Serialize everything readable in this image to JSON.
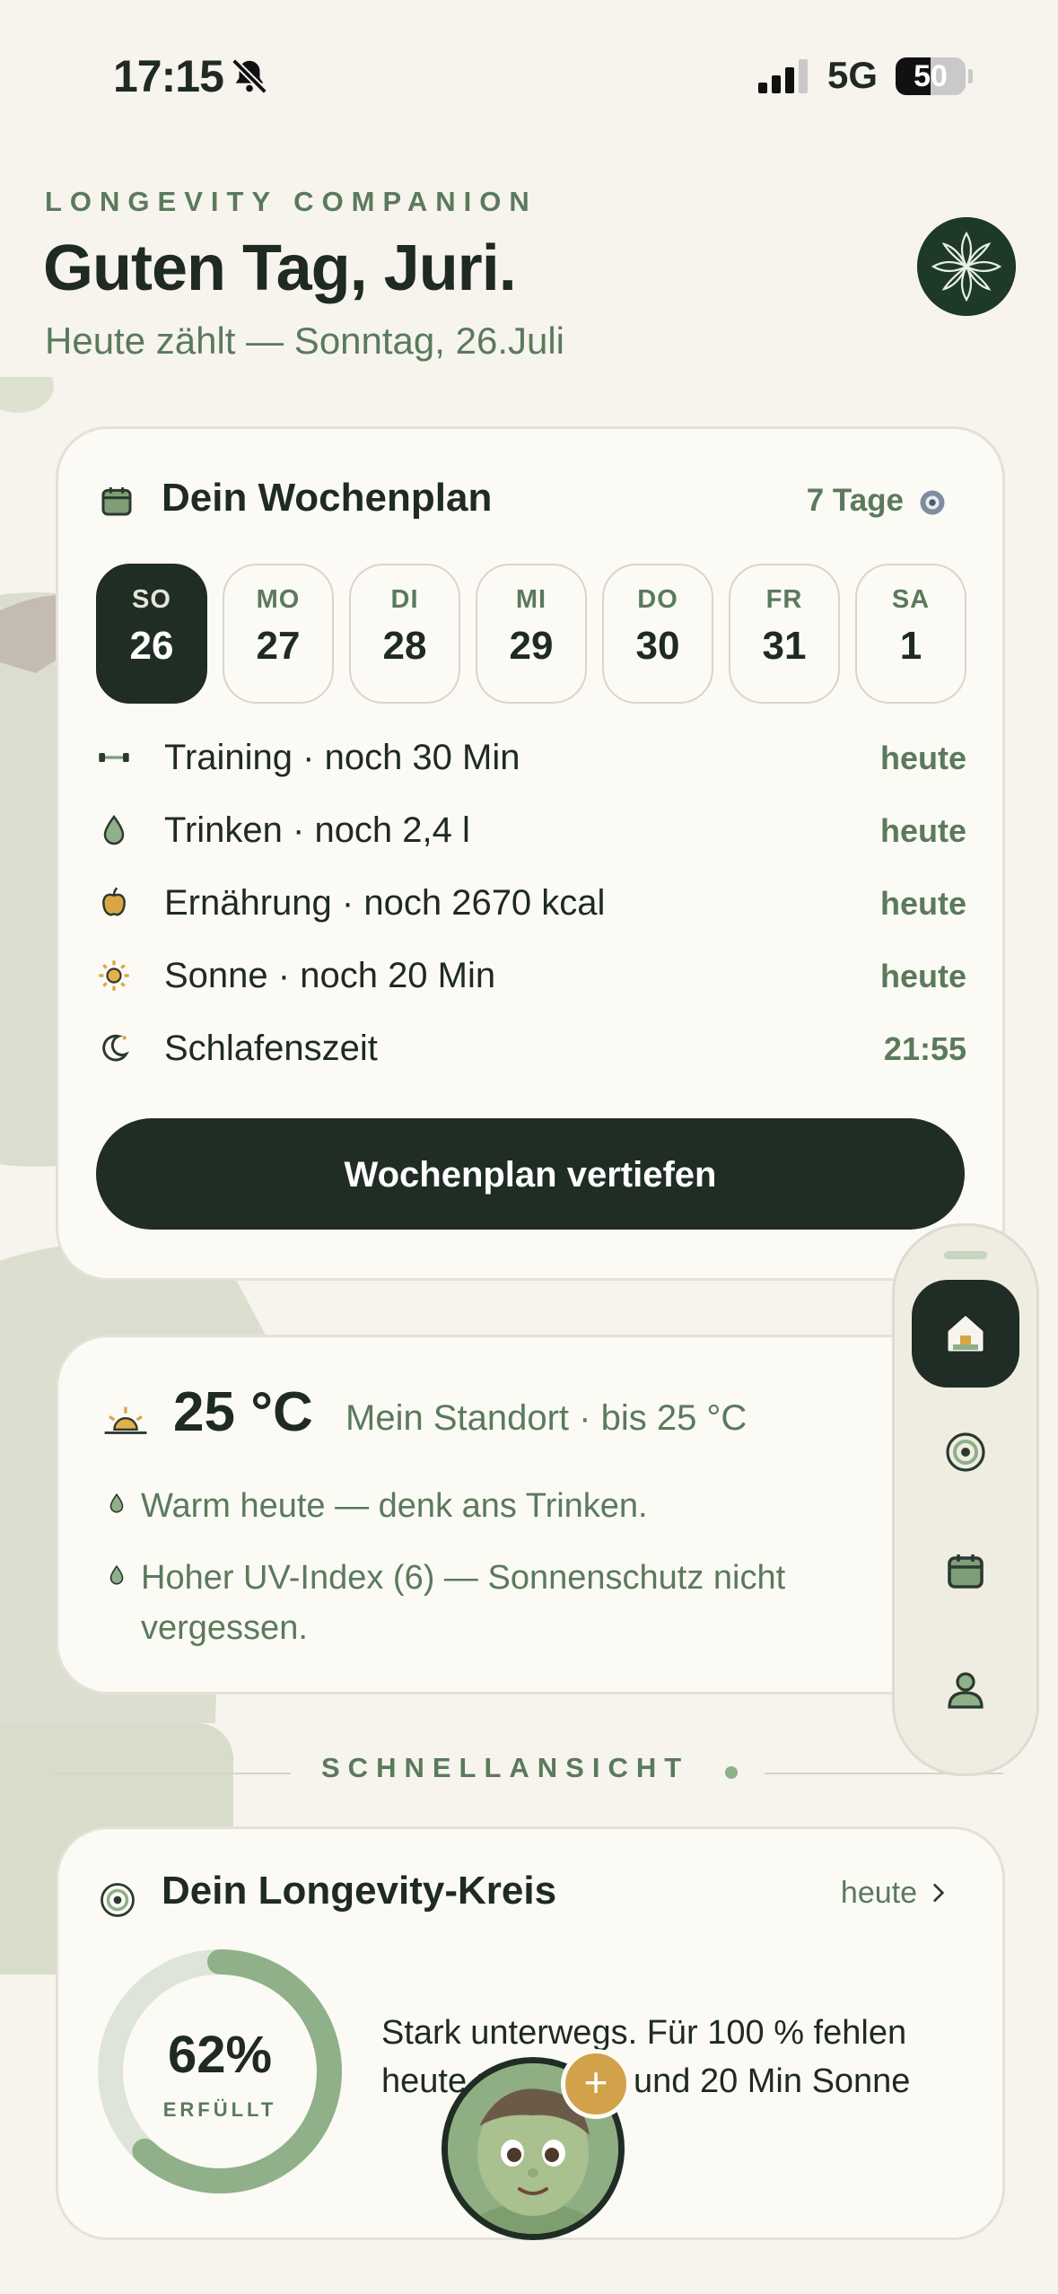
{
  "status_bar": {
    "time": "17:15",
    "network": "5G",
    "battery": "50"
  },
  "header": {
    "eyebrow": "LONGEVITY COMPANION",
    "greeting": "Guten Tag, Juri.",
    "subline": "Heute zählt — Sonntag, 26.Juli"
  },
  "weekplan": {
    "title": "Dein Wochenplan",
    "days_badge": "7 Tage",
    "days": [
      {
        "name": "SO",
        "date": "26",
        "active": true
      },
      {
        "name": "MO",
        "date": "27"
      },
      {
        "name": "DI",
        "date": "28"
      },
      {
        "name": "MI",
        "date": "29"
      },
      {
        "name": "DO",
        "date": "30"
      },
      {
        "name": "FR",
        "date": "31"
      },
      {
        "name": "SA",
        "date": "1"
      }
    ],
    "rows": [
      {
        "icon": "dumbbell-icon",
        "label": "Training · noch 30 Min",
        "value": "heute"
      },
      {
        "icon": "drop-icon",
        "label": "Trinken · noch 2,4 l",
        "value": "heute"
      },
      {
        "icon": "apple-icon",
        "label": "Ernährung · noch 2670 kcal",
        "value": "heute"
      },
      {
        "icon": "sun-icon",
        "label": "Sonne · noch 20 Min",
        "value": "heute"
      },
      {
        "icon": "moon-icon",
        "label": "Schlafenszeit",
        "value": "21:55"
      }
    ],
    "cta": "Wochenplan vertiefen"
  },
  "weather": {
    "temp": "25 °C",
    "location": "Mein Standort · bis 25 °C",
    "hints": [
      "Warm heute — denk ans Trinken.",
      "Hoher UV-Index (6) — Sonnenschutz nicht vergessen."
    ]
  },
  "section": {
    "label": "SCHNELLANSICHT"
  },
  "kreis": {
    "title": "Dein Longevity-Kreis",
    "link": "heute",
    "percent_value": 62,
    "percent": "62%",
    "percent_label": "ERFÜLLT",
    "text": "Stark unterwegs. Für 100 % fehlen heute noch 2,4 l und 20 Min Sonne"
  },
  "nav": {
    "items": [
      "home-icon",
      "target-icon",
      "calendar-icon",
      "profile-icon"
    ],
    "active": 0
  },
  "colors": {
    "accent_dark": "#1f2d24",
    "accent_green": "#5a7a5c",
    "ring": "#8fb089",
    "gold": "#d1a24a",
    "background": "#f7f4ee"
  }
}
